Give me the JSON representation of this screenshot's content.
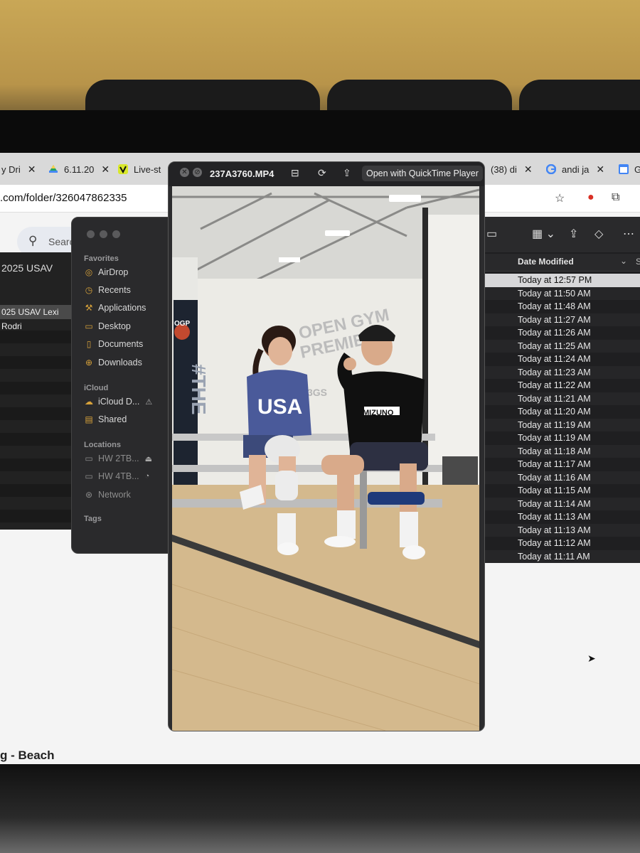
{
  "browser": {
    "tabs": [
      {
        "label": "y Dri",
        "icon": "drive-icon"
      },
      {
        "label": "6.11.20",
        "icon": "drive-icon"
      },
      {
        "label": "Live-st",
        "icon": "vimeo-icon"
      },
      {
        "label": "(38) di",
        "icon": "tab-icon"
      },
      {
        "label": "andi ja",
        "icon": "google-icon"
      },
      {
        "label": "G",
        "icon": "calendar-icon"
      }
    ],
    "url": ".com/folder/326047862335"
  },
  "drive": {
    "search_placeholder": "Search",
    "folder_header": "2025 USAV",
    "selected_item": "025 USAV Lexi Rodri",
    "bottom_text": "g - Beach"
  },
  "finder": {
    "sections": {
      "favorites": "Favorites",
      "icloud": "iCloud",
      "locations": "Locations",
      "tags": "Tags"
    },
    "favorites": [
      "AirDrop",
      "Recents",
      "Applications",
      "Desktop",
      "Documents",
      "Downloads"
    ],
    "icloud_items": [
      "iCloud D...",
      "Shared"
    ],
    "locations": [
      "HW 2TB...",
      "HW 4TB...",
      "Network"
    ],
    "column_header": "Date Modified",
    "column_header_next": "S",
    "dates": [
      "Today at 12:57 PM",
      "Today at 11:50 AM",
      "Today at 11:48 AM",
      "Today at 11:27 AM",
      "Today at 11:26 AM",
      "Today at 11:25 AM",
      "Today at 11:24 AM",
      "Today at 11:23 AM",
      "Today at 11:22 AM",
      "Today at 11:21 AM",
      "Today at 11:20 AM",
      "Today at 11:19 AM",
      "Today at 11:19 AM",
      "Today at 11:18 AM",
      "Today at 11:17 AM",
      "Today at 11:16 AM",
      "Today at 11:15 AM",
      "Today at 11:14 AM",
      "Today at 11:13 AM",
      "Today at 11:13 AM",
      "Today at 11:12 AM",
      "Today at 11:11 AM"
    ]
  },
  "quicklook": {
    "filename": "237A3760.MP4",
    "open_with": "Open with QuickTime Player"
  },
  "photo_text": {
    "wall_sign_line1": "OPEN GYM",
    "wall_sign_line2": "PREMIER",
    "shirt_left": "USA",
    "shirt_right": "MIZUNO",
    "banner": "#THE",
    "brand_logo": "OGP",
    "wall_small": "3GS"
  }
}
